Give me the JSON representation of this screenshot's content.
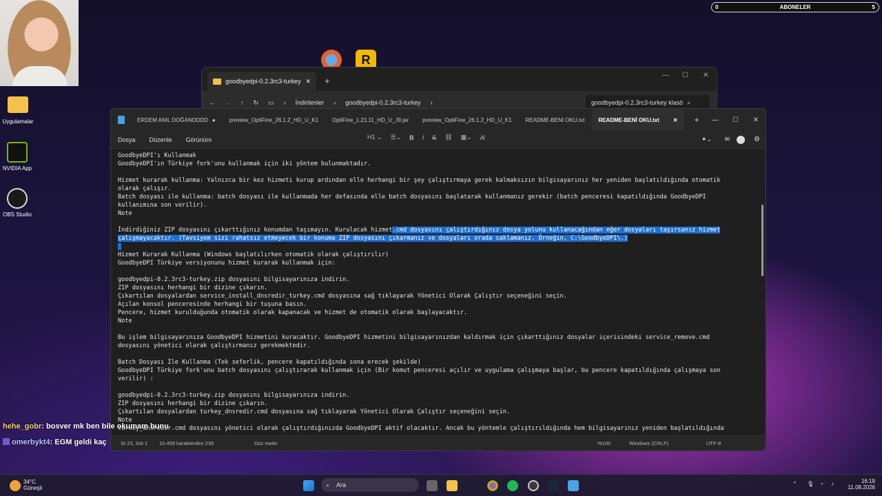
{
  "stream": {
    "subs_left": "0",
    "subs_label": "ABONELER",
    "subs_right": "5"
  },
  "desktop": {
    "icons": [
      {
        "label": "Uygulamalar"
      },
      {
        "label": "NVIDIA App"
      },
      {
        "label": "OBS Studio"
      }
    ]
  },
  "explorer": {
    "tab_title": "goodbyedpi-0.2.3rc3-turkey",
    "breadcrumb": [
      "İndirilenler",
      "goodbyedpi-0.2.3rc3-turkey"
    ],
    "search_placeholder": "goodbyedpi-0.2.3rc3-turkey klasö"
  },
  "notepad": {
    "tabs": [
      "ERDEM ANIL DOĞANDDDD",
      "preview_OptiFine_26.1.2_HD_U_K1",
      "OptiFine_1.21.11_HD_U_J9.jar",
      "preview_OptiFine_26.1.2_HD_U_K1",
      "README-BENİ OKU.txt",
      "README-BENİ OKU.txt"
    ],
    "menu": [
      "Dosya",
      "Düzenle",
      "Görünüm"
    ],
    "heading_select": "H1",
    "lines": [
      "GoodbyeDPI'ı Kullanmak",
      "GoodbyeDPI'ın Türkiye fork'unu kullanmak için iki yöntem bulunmaktadır.",
      "",
      "Hizmet kurarak kullanma: Yalnızca bir kez hizmeti kurup ardından elle herhangi bir şey çalıştırmaya gerek kalmaksızın bilgisayarınız her yeniden başlatıldığında otomatik",
      "olarak çalışır.",
      "Batch dosyası ile kullanma: batch dosyası ile kullanmada her defasında elle batch dosyasını başlatarak kullanmanız gerekir (batch penceresi kapatıldığında GoodbyeDPI",
      "kullanımına son verilir).",
      "Note",
      "",
      "İndirdiğiniz ZIP dosyasını çıkarttığınız konumdan taşımayın. Kurulacak hizmet",
      "çalışmayacaktır. (Tavsiyem sizi rahatsız etmeyecek bir konuma ZIP dosyasını çıkarmanız ve dosyaları orada saklamanız. Örneğin, C:\\GoodbyeDPI\\.)",
      "",
      "Hizmet Kurarak Kullanma (Windows başlatılırken otomatik olarak çalıştırılır)",
      "GoodbyeDPI Türkiye versiyonunu hizmet kurarak kullanmak için:",
      "",
      "goodbyedpi-0.2.3rc3-turkey.zip dosyasını bilgisayarınıza indirin.",
      "ZIP dosyasını herhangi bir dizine çıkarın.",
      "Çıkartılan dosyalardan service_install_dnsredir_turkey.cmd dosyasına sağ tıklayarak Yönetici Olarak Çalıştır seçeneğini seçin.",
      "Açılan konsol penceresinde herhangi bir tuşuna basın.",
      "Pencere, hizmet kurulduğunda otomatik olarak kapanacak ve hizmet de otomatik olarak başlayacaktır.",
      "Note",
      "",
      "Bu işlem bilgisayarınıza GoodbyeDPI hizmetini kuracaktır. GoodbyeDPI hizmetini bilgisayarınızdan kaldırmak için çıkarttığınız dosyalar içerisindeki service_remove.cmd",
      "dosyasını yönetici olarak çalıştırmanız gerekmektedir.",
      "",
      "Batch Dosyası İle Kullanma (Tek seferlik, pencere kapatıldığında sona erecek şekilde)",
      "GoodbyeDPI Türkiye fork'unu batch dosyasını çalıştırarak kullanmak için (Bir komut penceresi açılır ve uygulama çalışmaya başlar, bu pencere kapatıldığında çalışmaya son",
      "verilir) :",
      "",
      "goodbyedpi-0.2.3rc3-turkey.zip dosyasını bilgisayarınıza indirin.",
      "ZIP dosyasını herhangi bir dizine çıkarın.",
      "Çıkartılan dosyalardan turkey_dnsredir.cmd dosyasına sağ tıklayarak Yönetici Olarak Çalıştır seçeneğini seçin.",
      "Note",
      "turkey_dnsredir.cmd dosyasını yönetici olarak çalıştırdığınızda GoodbyeDPI aktif olacaktır. Ancak bu yöntemle çalıştırıldığında hem bilgisayarınız yeniden başlatıldığında"
    ],
    "selected_tail": ".cmd dosyasını çalıştırdığınız dosya yolunu kullanacağından eğer dosyaları taşırsanız hizmet",
    "status": {
      "position": "St 23, Süt 1",
      "chars": "10.459 karakterden 239",
      "mode": "Düz metin",
      "zoom": "%100",
      "eol": "Windows (CRLF)",
      "encoding": "UTF-8"
    }
  },
  "chat": [
    {
      "user": "hehe_gobr",
      "msg": ": bosver mk ben bile okumam bunu"
    },
    {
      "user": "omerbykt4",
      "msg": ": EGM geldi kaç"
    }
  ],
  "taskbar": {
    "weather_temp": "34°C",
    "weather_desc": "Güneşli",
    "search_label": "Ara",
    "time": "16:19",
    "date": "11.08.2026"
  }
}
